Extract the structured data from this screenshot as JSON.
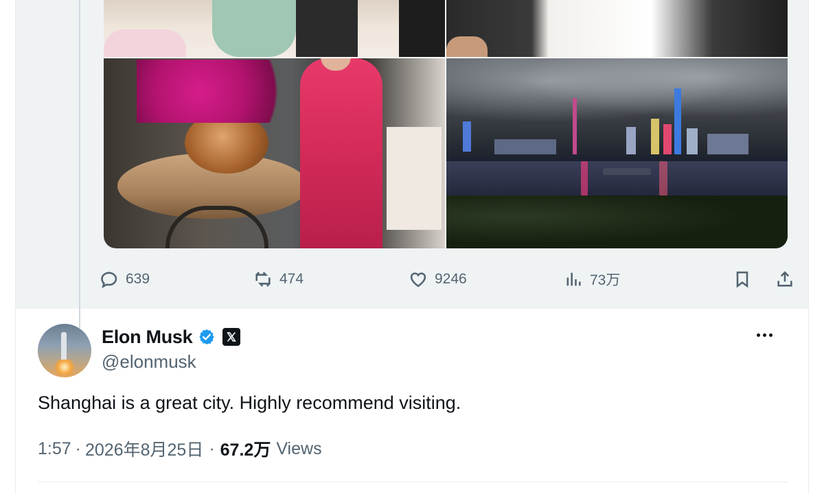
{
  "quoted_tweet": {
    "actions": {
      "reply_count": "639",
      "retweet_count": "474",
      "like_count": "9246",
      "views_count": "73万"
    }
  },
  "main_tweet": {
    "author": {
      "display_name": "Elon Musk",
      "handle": "@elonmusk"
    },
    "text": "Shanghai is a great city. Highly recommend visiting.",
    "meta": {
      "time": "1:57",
      "separator": "·",
      "date": "2026年8月25日",
      "views_count": "67.2万",
      "views_label": "Views"
    }
  },
  "colors": {
    "verified_badge": "#1d9bf0",
    "muted_text": "#536471",
    "primary_text": "#0f1419",
    "quoted_bg": "#eff3f4"
  }
}
